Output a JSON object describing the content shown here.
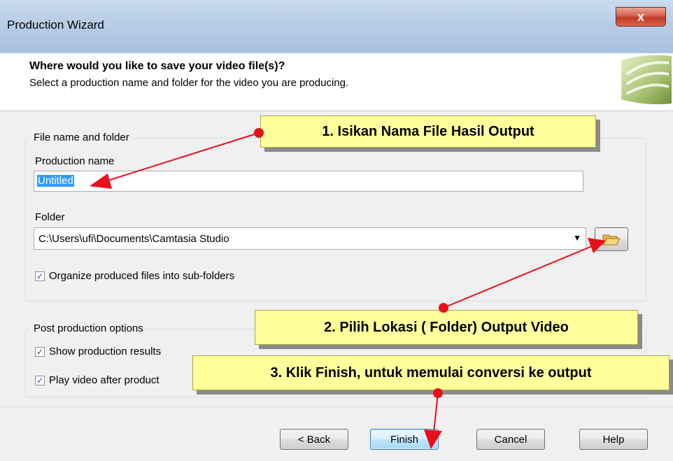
{
  "window": {
    "title": "Production Wizard",
    "close_glyph": "x"
  },
  "header": {
    "heading": "Where would you like to save your video file(s)?",
    "subheading": "Select a production name and folder for the video you are producing.",
    "logo_icon": "camtasia-logo-icon"
  },
  "file_group": {
    "label": "File name and folder",
    "production_name_label": "Production name",
    "production_name_value": "Untitled",
    "folder_label": "Folder",
    "folder_value": "C:\\Users\\ufi\\Documents\\Camtasia Studio",
    "organize_label": "Organize produced files into sub-folders",
    "organize_checked": true
  },
  "post_group": {
    "label": "Post production options",
    "show_results_label": "Show production results",
    "play_video_label": "Play video after product",
    "show_results_checked": true,
    "play_video_checked": true
  },
  "buttons": {
    "back": "< Back",
    "finish": "Finish",
    "cancel": "Cancel",
    "help": "Help"
  },
  "callouts": {
    "one": "1. Isikan Nama File Hasil Output",
    "two": "2. Pilih Lokasi ( Folder) Output Video",
    "three": "3. Klik Finish, untuk memulai conversi ke output"
  },
  "colors": {
    "callout_bg": "#ffff9c",
    "arrow": "#e8101a",
    "selection": "#3399ff"
  }
}
